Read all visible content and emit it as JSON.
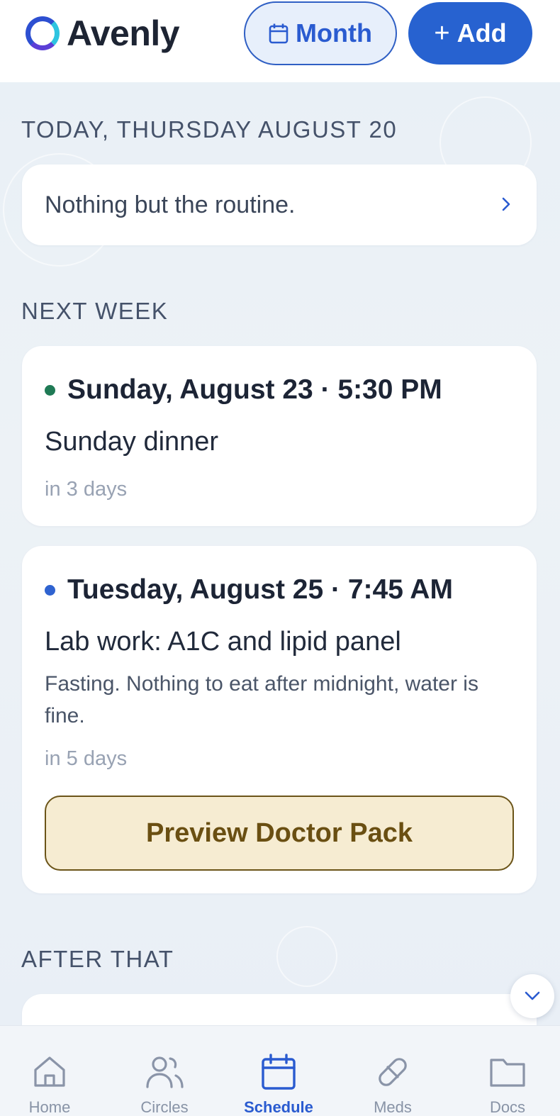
{
  "header": {
    "brand": "Avenly",
    "month_button": "Month",
    "add_button": "Add",
    "add_icon": "plus-icon"
  },
  "today": {
    "heading": "TODAY, THURSDAY AUGUST 20",
    "summary": "Nothing but the routine."
  },
  "next_week": {
    "heading": "NEXT WEEK",
    "events": [
      {
        "date_time": "Sunday, August 23 · 5:30 PM",
        "title": "Sunday dinner",
        "relative": "in 3 days",
        "dot_color": "#1f7a55"
      },
      {
        "date_time": "Tuesday, August 25 · 7:45 AM",
        "title": "Lab work: A1C and lipid panel",
        "note": "Fasting. Nothing to eat after midnight, water is fine.",
        "relative": "in 5 days",
        "dot_color": "#2f63d0",
        "action": "Preview Doctor Pack"
      }
    ]
  },
  "after": {
    "heading": "AFTER THAT"
  },
  "nav": {
    "items": [
      {
        "label": "Home",
        "icon": "home-icon",
        "active": false
      },
      {
        "label": "Circles",
        "icon": "users-icon",
        "active": false
      },
      {
        "label": "Schedule",
        "icon": "calendar-icon",
        "active": true
      },
      {
        "label": "Meds",
        "icon": "pill-icon",
        "active": false
      },
      {
        "label": "Docs",
        "icon": "folder-icon",
        "active": false
      }
    ]
  },
  "colors": {
    "accent": "#2762d0",
    "doctor_pack_bg": "#f6ecd2",
    "doctor_pack_text": "#6a4f12"
  }
}
